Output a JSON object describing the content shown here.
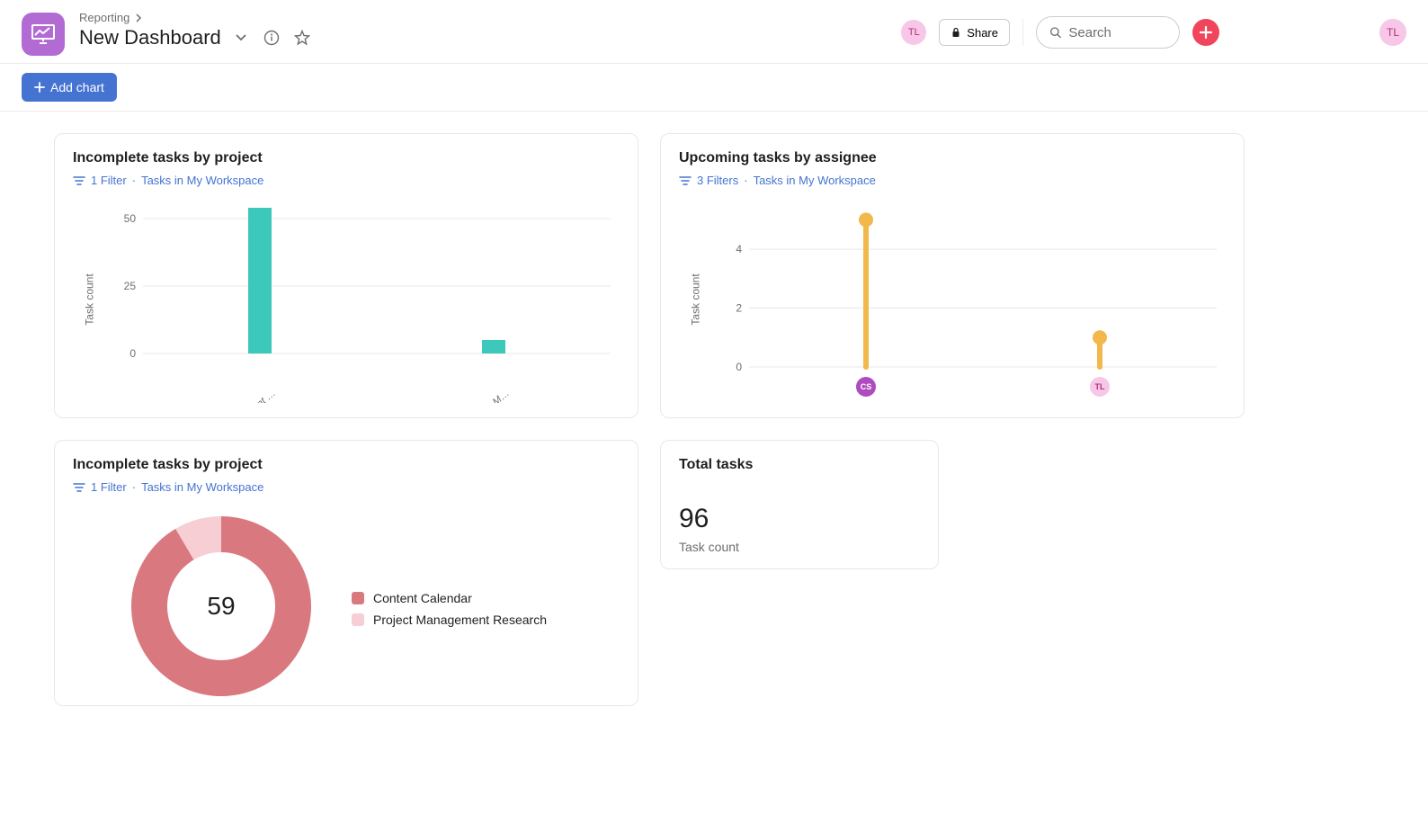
{
  "colors": {
    "accent_purple": "#b36bd4",
    "accent_blue": "#4573d2",
    "accent_red": "#f1455b",
    "bar_teal": "#3cc8ba",
    "lolli_orange": "#f2b84b",
    "donut_dark": "#d9797f",
    "donut_light": "#f7ced3",
    "avatar_pink_bg": "#f8c6e6",
    "avatar_pink_fg": "#b1317a",
    "avatar_aa_bg": "#ad4bbf"
  },
  "header": {
    "breadcrumb_parent": "Reporting",
    "title": "New Dashboard",
    "share_label": "Share",
    "search_placeholder": "Search",
    "user_initials": "TL",
    "visitor_initials": "TL"
  },
  "toolbar": {
    "add_chart_label": "Add chart"
  },
  "cards": {
    "bar1": {
      "title": "Incomplete tasks by project",
      "filter_text": "1 Filter",
      "scope_text": "Tasks in My Workspace",
      "ylabel": "Task count"
    },
    "lolli": {
      "title": "Upcoming tasks by assignee",
      "filter_text": "3 Filters",
      "scope_text": "Tasks in My Workspace",
      "ylabel": "Task count"
    },
    "donut": {
      "title": "Incomplete tasks by project",
      "filter_text": "1 Filter",
      "scope_text": "Tasks in My Workspace",
      "center_value": "59",
      "legend1": "Content Calendar",
      "legend2": "Project Management Research"
    },
    "total": {
      "title": "Total tasks",
      "value": "96",
      "sub": "Task count"
    }
  },
  "chart_data": [
    {
      "id": "bar1",
      "type": "bar",
      "title": "Incomplete tasks by project",
      "xlabel": "",
      "ylabel": "Task count",
      "ylim": [
        0,
        55
      ],
      "yticks": [
        0,
        25,
        50
      ],
      "categories": [
        "Content …",
        "Project M…"
      ],
      "category_full_names": [
        "Content Calendar",
        "Project Management Research"
      ],
      "values": [
        54,
        5
      ],
      "bar_color": "#3cc8ba"
    },
    {
      "id": "lolli",
      "type": "bar",
      "subtype": "lollipop",
      "title": "Upcoming tasks by assignee",
      "xlabel": "",
      "ylabel": "Task count",
      "ylim": [
        0,
        5.5
      ],
      "yticks": [
        0,
        2,
        4
      ],
      "categories": [
        "CS",
        "TL"
      ],
      "category_avatar_colors": [
        "#ad4bbf",
        "#f8c6e6"
      ],
      "values": [
        5,
        1
      ],
      "color": "#f2b84b"
    },
    {
      "id": "donut",
      "type": "pie",
      "subtype": "donut",
      "title": "Incomplete tasks by project",
      "categories": [
        "Content Calendar",
        "Project Management Research"
      ],
      "values": [
        54,
        5
      ],
      "total_label": 59,
      "colors": [
        "#d9797f",
        "#f7ced3"
      ]
    },
    {
      "id": "total",
      "type": "table",
      "title": "Total tasks",
      "value": 96,
      "label": "Task count"
    }
  ]
}
